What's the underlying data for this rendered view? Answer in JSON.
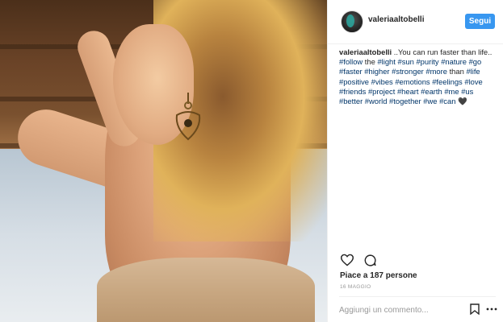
{
  "post": {
    "username": "valeriaaltobelli",
    "follow_label": "Segui",
    "caption": {
      "user": "valeriaaltobelli",
      "text_start": " ..You can run faster than life.. ",
      "hashtags": [
        "#follow",
        "the",
        "#light",
        "#sun",
        "#purity",
        "#nature",
        "#go",
        "#faster",
        "#higher",
        "#stronger",
        "#more",
        "than",
        "#life",
        "#positive",
        "#vibes",
        "#emotions",
        "#feelings",
        "#love",
        "#friends",
        "#project",
        "#heart",
        "#earth",
        "#me",
        "#us",
        "#better",
        "#world",
        "#together",
        "#we",
        "#can"
      ],
      "emoji": "🖤"
    },
    "likes_text": "Piace a 187 persone",
    "date": "16 MAGGIO",
    "comment_placeholder": "Aggiungi un commento..."
  },
  "icons": {
    "like": "heart-icon",
    "comment": "comment-icon",
    "save": "bookmark-icon",
    "options": "more-options-icon"
  }
}
